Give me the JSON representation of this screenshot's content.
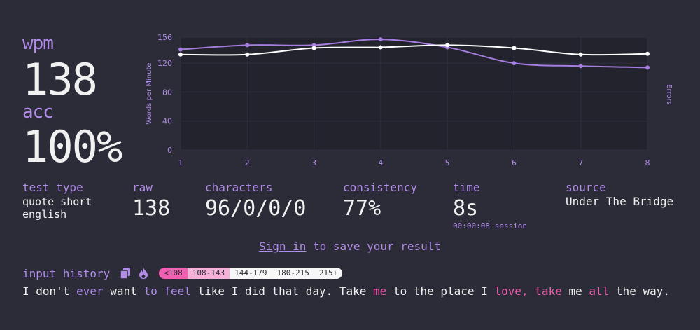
{
  "summary": {
    "wpm_label": "wpm",
    "wpm_value": "138",
    "acc_label": "acc",
    "acc_value": "100%"
  },
  "chart_data": {
    "type": "line",
    "x": [
      1,
      2,
      3,
      4,
      5,
      6,
      7,
      8
    ],
    "xticks": [
      "1",
      "2",
      "3",
      "4",
      "5",
      "6",
      "7",
      "8"
    ],
    "yticks": [
      "0",
      "40",
      "80",
      "120",
      "156"
    ],
    "ylim": [
      0,
      156
    ],
    "ylabel": "Words per Minute",
    "y2label": "Errors",
    "series": [
      {
        "color": "#ffffff",
        "values": [
          132,
          132,
          141,
          142,
          145,
          141,
          132,
          133
        ]
      },
      {
        "color": "#a57ee0",
        "values": [
          139,
          145,
          145,
          153,
          142,
          120,
          116,
          114
        ]
      }
    ]
  },
  "stats": {
    "test_type_label": "test type",
    "test_type_line1": "quote short",
    "test_type_line2": "english",
    "raw_label": "raw",
    "raw_value": "138",
    "characters_label": "characters",
    "characters_value": "96/0/0/0",
    "consistency_label": "consistency",
    "consistency_value": "77%",
    "time_label": "time",
    "time_value": "8s",
    "time_session": "00:00:08 session",
    "source_label": "source",
    "source_value": "Under The Bridge"
  },
  "signin": {
    "link_text": "Sign in",
    "rest_text": " to save your result"
  },
  "history": {
    "label": "input history",
    "legend": [
      "<108",
      "108-143",
      "144-179",
      "180-215",
      "215+"
    ],
    "legend_colors": [
      "#f25fb1",
      "#f4b2d8",
      "#f7f7f7",
      "#f7f7f7",
      "#f7f7f7"
    ],
    "words": [
      {
        "t": "I",
        "c": "n"
      },
      {
        "t": "don't",
        "c": "n"
      },
      {
        "t": "ever",
        "c": "p"
      },
      {
        "t": "want",
        "c": "n"
      },
      {
        "t": "to",
        "c": "p"
      },
      {
        "t": "feel",
        "c": "p"
      },
      {
        "t": "like",
        "c": "n"
      },
      {
        "t": "I",
        "c": "n"
      },
      {
        "t": "did",
        "c": "n"
      },
      {
        "t": "that",
        "c": "n"
      },
      {
        "t": "day.",
        "c": "n"
      },
      {
        "t": "Take",
        "c": "n"
      },
      {
        "t": "me",
        "c": "k"
      },
      {
        "t": "to",
        "c": "n"
      },
      {
        "t": "the",
        "c": "n"
      },
      {
        "t": "place",
        "c": "n"
      },
      {
        "t": "I",
        "c": "n"
      },
      {
        "t": "love,",
        "c": "k"
      },
      {
        "t": "take",
        "c": "k"
      },
      {
        "t": "me",
        "c": "n"
      },
      {
        "t": "all",
        "c": "k"
      },
      {
        "t": "the",
        "c": "n"
      },
      {
        "t": "way.",
        "c": "n"
      }
    ]
  }
}
